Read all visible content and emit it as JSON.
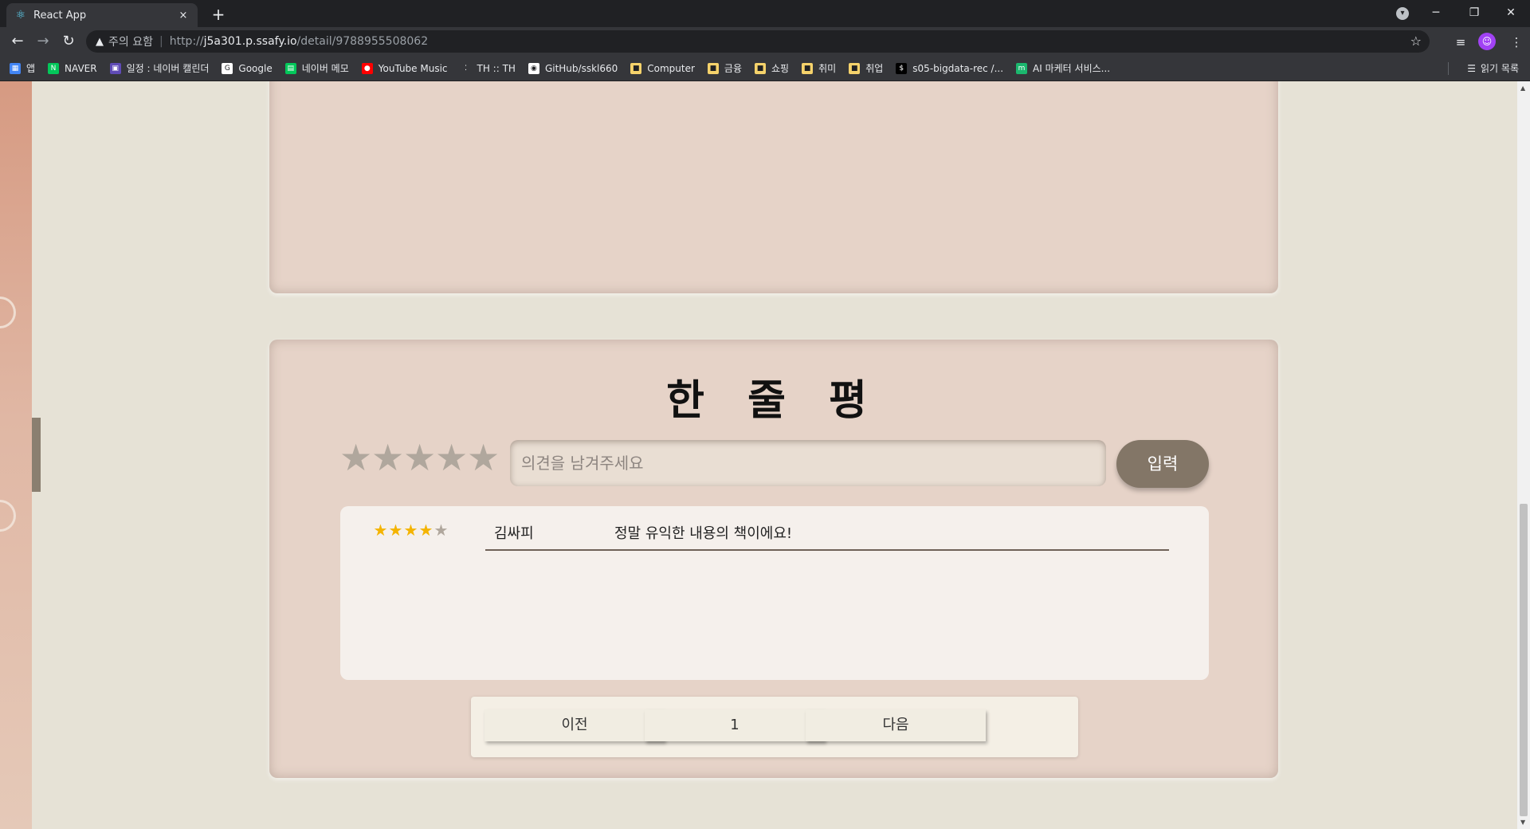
{
  "browser": {
    "tab_title": "React App",
    "tab_close": "×",
    "new_tab": "+",
    "security_label": "주의 요함",
    "url_scheme": "http://",
    "url_host": "j5a301.p.ssafy.io",
    "url_path": "/detail/9788955508062",
    "reading_list": "읽기 목록",
    "bookmarks": [
      {
        "label": "앱",
        "color": "#4285f4"
      },
      {
        "label": "NAVER",
        "color": "#03c75a"
      },
      {
        "label": "일정 : 네이버 캘린더",
        "color": "#5f4bb6"
      },
      {
        "label": "Google",
        "color": "#ffffff"
      },
      {
        "label": "네이버 메모",
        "color": "#03c75a"
      },
      {
        "label": "YouTube Music",
        "color": "#ff0000"
      },
      {
        "label": "TH :: TH",
        "color": "#35363a"
      },
      {
        "label": "GitHub/sskl660",
        "color": "#ffffff"
      },
      {
        "label": "Computer",
        "color": "#f5d26b"
      },
      {
        "label": "금융",
        "color": "#f5d26b"
      },
      {
        "label": "쇼핑",
        "color": "#f5d26b"
      },
      {
        "label": "취미",
        "color": "#f5d26b"
      },
      {
        "label": "취업",
        "color": "#f5d26b"
      },
      {
        "label": "s05-bigdata-rec /...",
        "color": "#000000"
      },
      {
        "label": "AI 마케터 서비스...",
        "color": "#1bb76e"
      }
    ]
  },
  "review": {
    "title": "한 줄 평",
    "input_placeholder": "의견을 남겨주세요",
    "submit_label": "입력",
    "picker_stars": 5,
    "entries": [
      {
        "rating": 4,
        "max": 5,
        "user": "김싸피",
        "text": "정말 유익한 내용의 책이에요!"
      }
    ]
  },
  "pagination": {
    "prev": "이전",
    "page": "1",
    "next": "다음"
  },
  "colors": {
    "star_filled": "#f4b400",
    "star_empty": "#b0a79d",
    "accent": "#837667",
    "card": "#e6d3c8",
    "page_bg": "#e6e2d6"
  }
}
